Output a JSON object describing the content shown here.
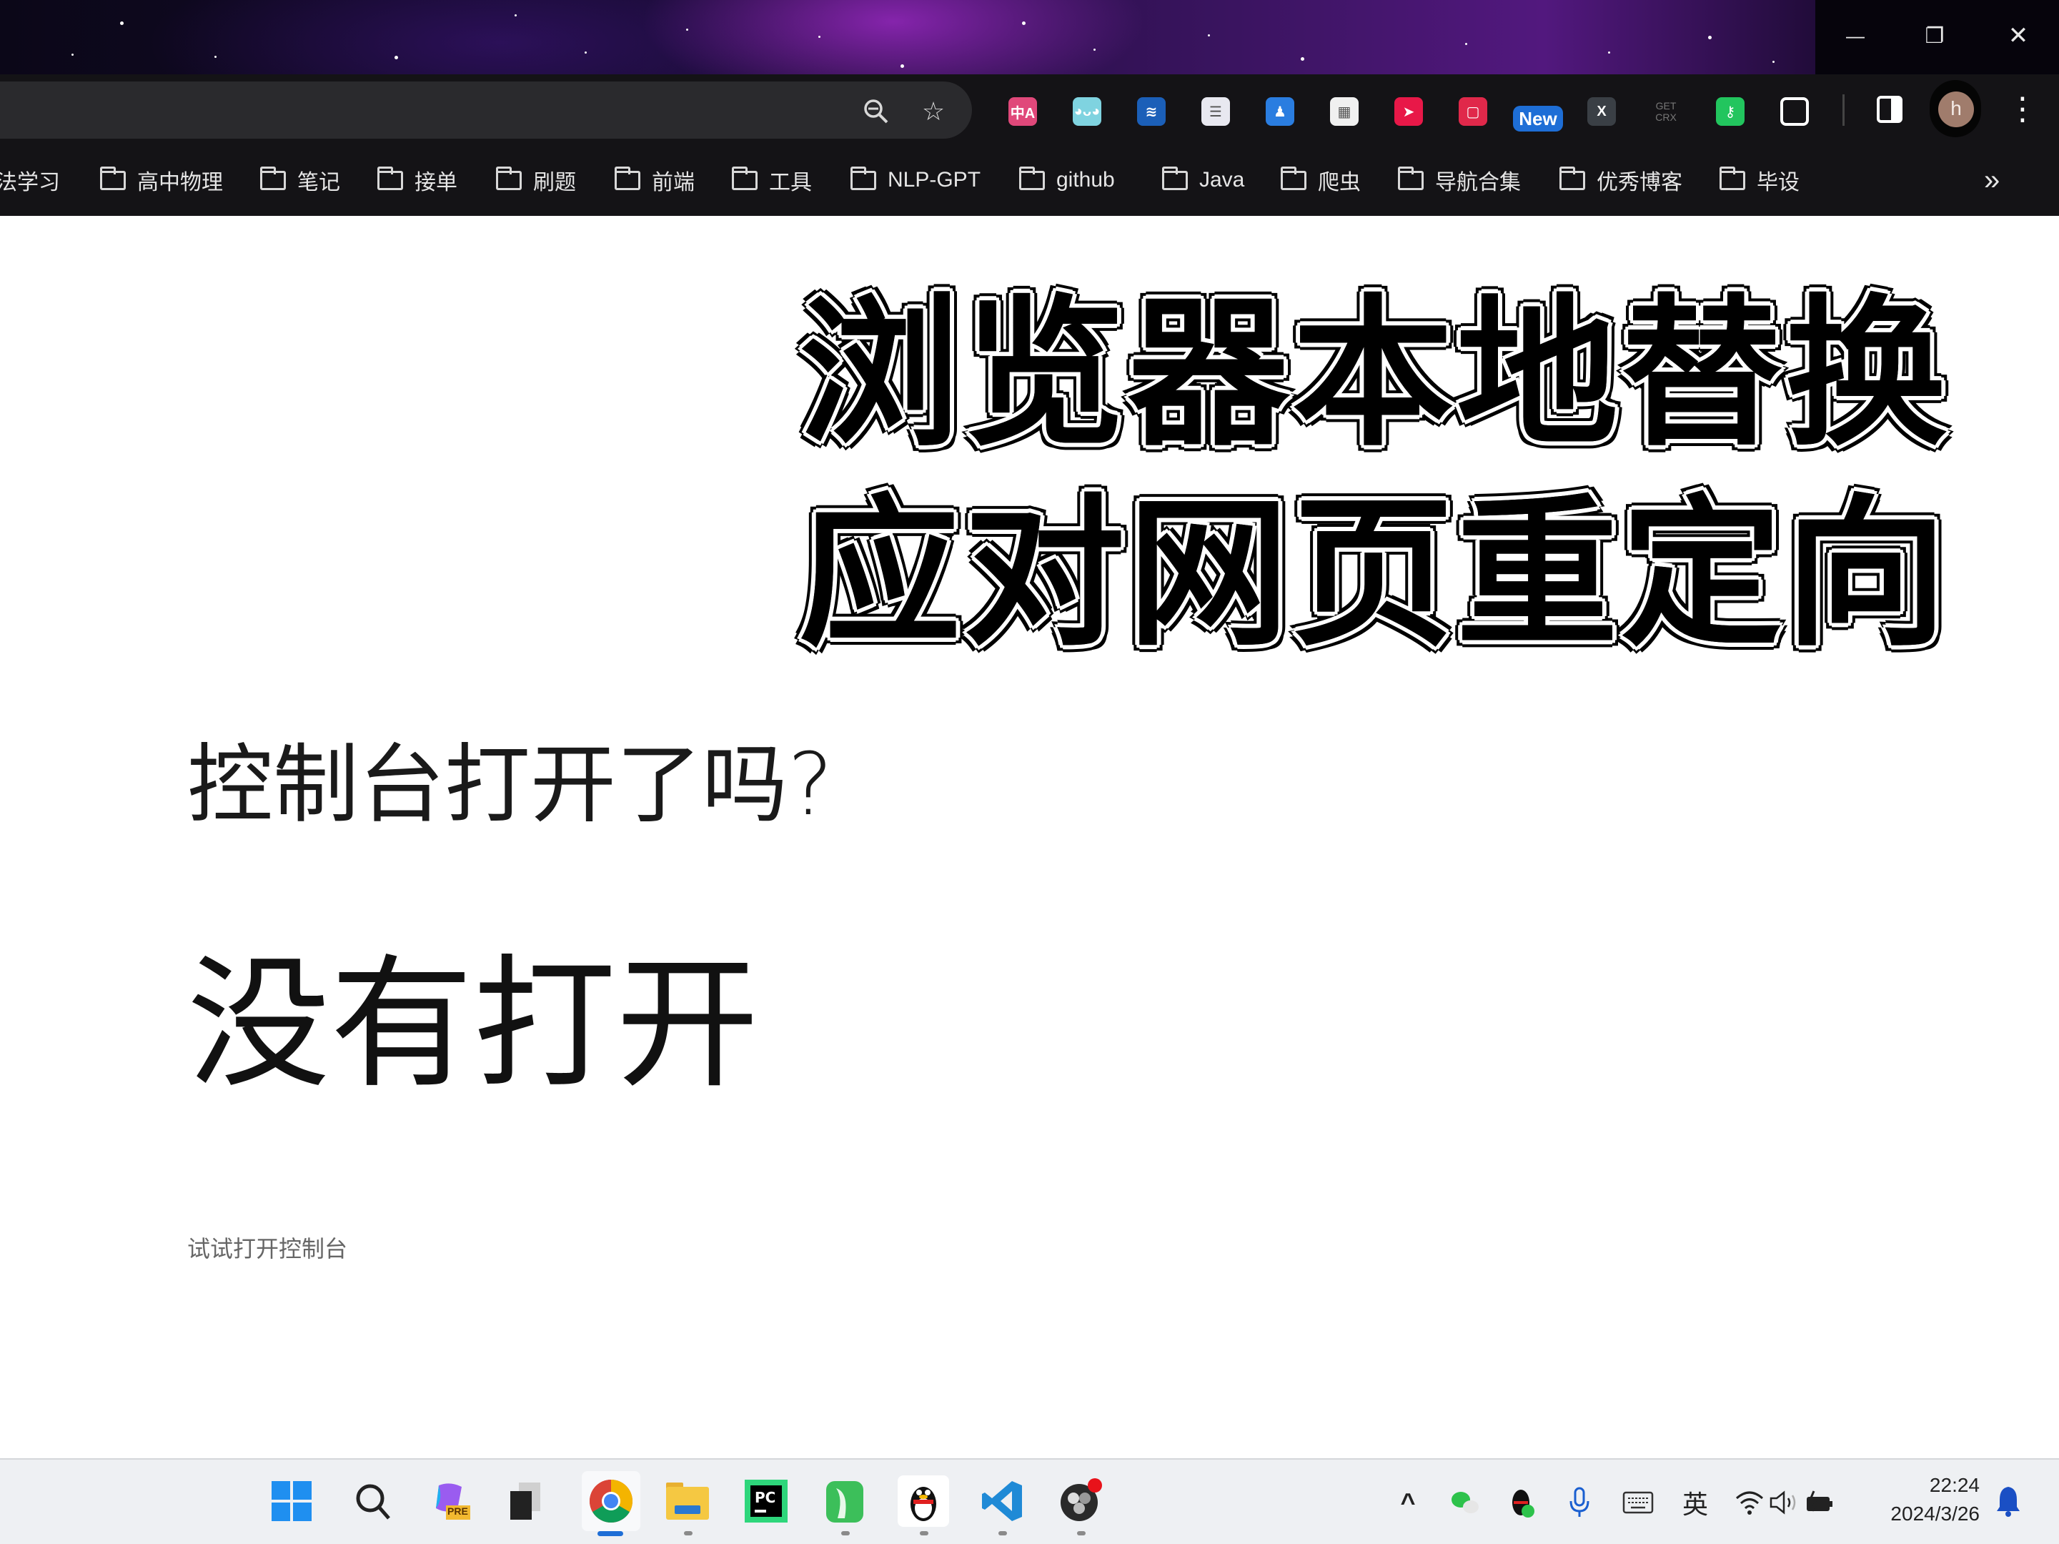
{
  "window": {
    "controls": {
      "minimize_icon": "minimize-icon",
      "restore_icon": "restore-icon",
      "close_icon": "close-icon",
      "minimize_glyph": "—",
      "restore_glyph": "❐",
      "close_glyph": "✕"
    }
  },
  "toolbar": {
    "omnibox_icons": [
      {
        "name": "zoom-icon",
        "glyph": "🔍︎"
      },
      {
        "name": "bookmark-star-icon",
        "glyph": "☆"
      }
    ],
    "extensions": [
      {
        "name": "translate-extension-icon",
        "label": "中A",
        "color": "#e0487a"
      },
      {
        "name": "bilibili-extension-icon",
        "label": "◕ᴗ◕",
        "color": "#7fd3e0"
      },
      {
        "name": "layers-extension-icon",
        "label": "≋",
        "color": "#1b5fb8"
      },
      {
        "name": "notes-extension-icon",
        "label": "☰",
        "color": "#e8e8f0"
      },
      {
        "name": "user-extension-icon",
        "label": "♟",
        "color": "#2a7de0"
      },
      {
        "name": "qrcode-extension-icon",
        "label": "▦",
        "color": "#f0f0f0"
      },
      {
        "name": "cursor-extension-icon",
        "label": "➤",
        "color": "#e81848"
      },
      {
        "name": "square-extension-icon",
        "label": "▢",
        "color": "#e0284a"
      },
      {
        "name": "new-extension-icon",
        "label": "New",
        "color": "#1e6ed6"
      },
      {
        "name": "x-extension-icon",
        "label": "X",
        "color": "#3a3f45"
      },
      {
        "name": "getcrx-extension-icon",
        "label": "GET CRX",
        "color": "transparent"
      },
      {
        "name": "key-extension-icon",
        "label": "⚷",
        "color": "#22c55e"
      },
      {
        "name": "extensions-puzzle-icon",
        "label": "⧉",
        "color": "transparent"
      }
    ],
    "side_panel_icon": "side-panel-icon",
    "profile_initial": "h",
    "menu_glyph": "⋮"
  },
  "bookmarks": {
    "items": [
      {
        "label": "法学习",
        "folder": false
      },
      {
        "label": "高中物理",
        "folder": true
      },
      {
        "label": "笔记",
        "folder": true
      },
      {
        "label": "接单",
        "folder": true
      },
      {
        "label": "刷题",
        "folder": true
      },
      {
        "label": "前端",
        "folder": true
      },
      {
        "label": "工具",
        "folder": true
      },
      {
        "label": "NLP-GPT",
        "folder": true
      },
      {
        "label": "github",
        "folder": true
      },
      {
        "label": "Java",
        "folder": true
      },
      {
        "label": "爬虫",
        "folder": true
      },
      {
        "label": "导航合集",
        "folder": true
      },
      {
        "label": "优秀博客",
        "folder": true
      },
      {
        "label": "毕设",
        "folder": true
      }
    ],
    "overflow_glyph": "»"
  },
  "page": {
    "overlay_title_line1": "浏览器本地替换",
    "overlay_title_line2": "应对网页重定向",
    "question": "控制台打开了吗?",
    "answer": "没有打开",
    "hint": "试试打开控制台"
  },
  "taskbar": {
    "apps": [
      {
        "name": "start-button",
        "icon": "windows-logo-icon",
        "running": false
      },
      {
        "name": "search-button",
        "icon": "search-icon",
        "running": false
      },
      {
        "name": "copilot-app",
        "icon": "copilot-pre-icon",
        "badge": "PRE",
        "running": false
      },
      {
        "name": "task-view-app",
        "icon": "task-view-icon",
        "running": false
      },
      {
        "name": "chrome-app",
        "icon": "chrome-icon",
        "running": true,
        "active": true
      },
      {
        "name": "file-explorer-app",
        "icon": "folder-icon",
        "running": true
      },
      {
        "name": "pycharm-app",
        "icon": "pycharm-icon",
        "label": "PC",
        "running": false
      },
      {
        "name": "green-app",
        "icon": "green-app-icon",
        "running": true
      },
      {
        "name": "qq-app",
        "icon": "qq-penguin-icon",
        "running": true
      },
      {
        "name": "vscode-app",
        "icon": "vscode-icon",
        "running": true
      },
      {
        "name": "obs-app",
        "icon": "obs-icon",
        "running": true,
        "notification": true
      }
    ],
    "tray": {
      "chevron_glyph": "^",
      "wechat_icon": "wechat-icon",
      "qq_icon": "qq-tray-icon",
      "mic_icon": "microphone-icon",
      "keyboard_icon": "keyboard-icon",
      "ime_label": "英",
      "wifi_icon": "wifi-icon",
      "volume_icon": "volume-icon",
      "battery_icon": "battery-charging-icon",
      "time": "22:24",
      "date": "2024/3/26",
      "notification_icon": "bell-icon"
    }
  },
  "colors": {
    "toolbar_bg": "#141316",
    "omnibox_bg": "#2a2a2d",
    "taskbar_bg": "#eef0f3",
    "chrome_indicator": "#1e6ed6",
    "notification_bell": "#1a4fc4",
    "avatar": "#a07c6c"
  }
}
